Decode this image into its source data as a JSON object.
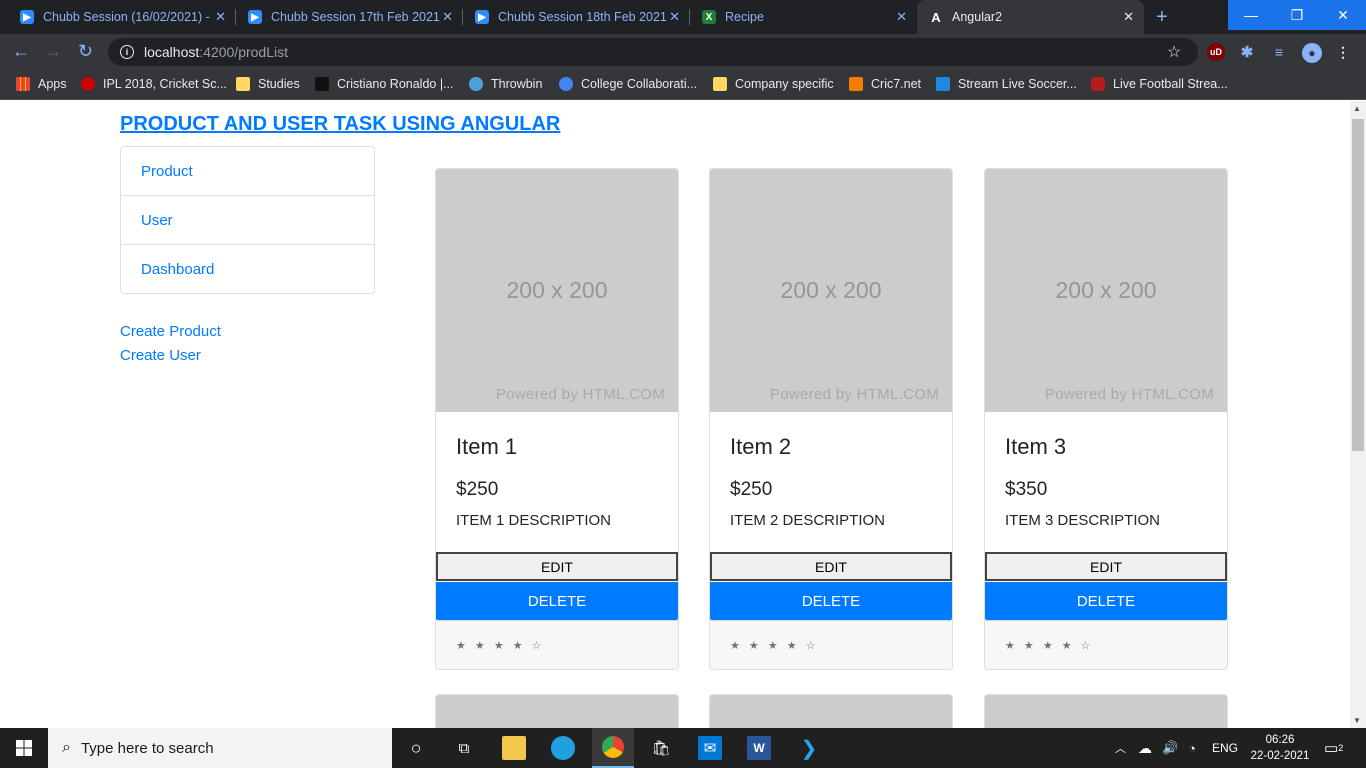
{
  "browser": {
    "tabs": [
      {
        "title": "Chubb Session (16/02/2021) -",
        "icon": "zoom-icon",
        "active": false
      },
      {
        "title": "Chubb Session 17th Feb 2021",
        "icon": "zoom-icon",
        "active": false
      },
      {
        "title": "Chubb Session 18th Feb 2021",
        "icon": "zoom-icon",
        "active": false
      },
      {
        "title": "Recipe",
        "icon": "spreadsheet-icon",
        "active": false
      },
      {
        "title": "Angular2",
        "icon": "angular-icon",
        "active": true
      }
    ],
    "address": {
      "host": "localhost",
      "path": ":4200/prodList"
    },
    "bookmarks": [
      {
        "label": "Apps"
      },
      {
        "label": "IPL 2018, Cricket Sc..."
      },
      {
        "label": "Studies"
      },
      {
        "label": "Cristiano Ronaldo |..."
      },
      {
        "label": "Throwbin"
      },
      {
        "label": "College Collaborati..."
      },
      {
        "label": "Company specific"
      },
      {
        "label": "Cric7.net"
      },
      {
        "label": "Stream Live Soccer..."
      },
      {
        "label": "Live Football Strea..."
      }
    ]
  },
  "app": {
    "title": "PRODUCT AND USER TASK USING ANGULAR",
    "nav": [
      "Product",
      "User",
      "Dashboard"
    ],
    "links": {
      "create_product": "Create Product",
      "create_user": "Create User"
    },
    "placeholder": {
      "size": "200 x 200",
      "powered": "Powered by HTML.COM"
    },
    "products": [
      {
        "name": "Item 1",
        "price": "$250",
        "description": "ITEM 1 DESCRIPTION",
        "edit": "EDIT",
        "delete": "DELETE",
        "rating": "★ ★ ★ ★ ☆"
      },
      {
        "name": "Item 2",
        "price": "$250",
        "description": "ITEM 2 DESCRIPTION",
        "edit": "EDIT",
        "delete": "DELETE",
        "rating": "★ ★ ★ ★ ☆"
      },
      {
        "name": "Item 3",
        "price": "$350",
        "description": "ITEM 3 DESCRIPTION",
        "edit": "EDIT",
        "delete": "DELETE",
        "rating": "★ ★ ★ ★ ☆"
      }
    ],
    "accent_color": "#007bff"
  },
  "taskbar": {
    "search_placeholder": "Type here to search",
    "language": "ENG",
    "time": "06:26",
    "date": "22-02-2021",
    "notifications": "2"
  }
}
